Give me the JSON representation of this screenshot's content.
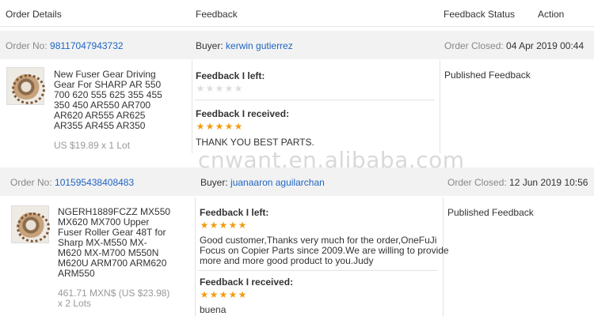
{
  "header": {
    "order_details": "Order Details",
    "feedback": "Feedback",
    "feedback_status": "Feedback Status",
    "action": "Action"
  },
  "orders": [
    {
      "order_no_label": "Order No:",
      "order_no": "98117047943732",
      "buyer_label": "Buyer:",
      "buyer": "kerwin gutierrez",
      "closed_label": "Order Closed:",
      "closed_date": "04 Apr 2019 00:44",
      "product_title_lines": [
        "New Fuser Gear Driving",
        "Gear For SHARP AR 550",
        "700 620 555 625 355 455",
        "350 450 AR550 AR700",
        "AR620 AR555 AR625",
        "AR355 AR455 AR350"
      ],
      "price": "US $19.89 x 1 Lot",
      "feedback_left_label": "Feedback I left:",
      "feedback_left_stars": 0,
      "feedback_left_text": "",
      "feedback_received_label": "Feedback I received:",
      "feedback_received_stars": 5,
      "feedback_received_text": "THANK YOU BEST PARTS.",
      "status": "Published Feedback"
    },
    {
      "order_no_label": "Order No:",
      "order_no": "101595438408483",
      "buyer_label": "Buyer:",
      "buyer": "juanaaron aguilarchan",
      "closed_label": "Order Closed:",
      "closed_date": "12 Jun 2019 10:56",
      "product_title_lines": [
        "NGERH1889FCZZ MX550",
        "MX620 MX700 Upper",
        "Fuser Roller Gear 48T for",
        "Sharp MX-M550 MX-",
        "M620 MX-M700 M550N",
        "M620U ARM700 ARM620",
        "ARM550"
      ],
      "price_line1": "461.71 MXN$ (US $23.98)",
      "price_line2": "x 2 Lots",
      "feedback_left_label": "Feedback I left:",
      "feedback_left_stars": 5,
      "feedback_left_text_lines": [
        "Good customer,Thanks very much for the order,OneFuJi",
        "Focus on Copier Parts since 2009.We are willing to provide",
        "more and more good product to you.Judy"
      ],
      "feedback_received_label": "Feedback I received:",
      "feedback_received_stars": 5,
      "feedback_received_text": "buena",
      "status": "Published Feedback"
    }
  ],
  "watermark": "cnwant.en.alibaba.com",
  "colors": {
    "link": "#1f65c2",
    "star": "#f39c12",
    "bar": "#f2f2f2"
  }
}
